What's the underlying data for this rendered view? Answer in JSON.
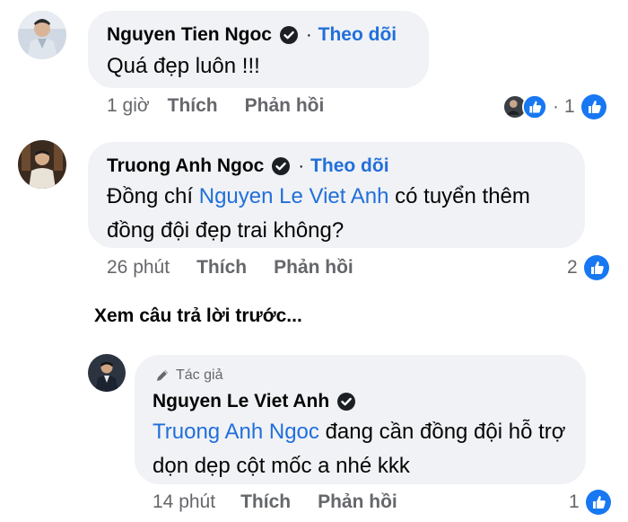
{
  "comments": [
    {
      "author": "Nguyen Tien Ngoc",
      "follow": "Theo dõi",
      "dot": "·",
      "text": "Quá đẹp luôn !!!",
      "time": "1 giờ",
      "like": "Thích",
      "reply": "Phản hồi",
      "reaction_count": "1",
      "reaction_dot": "·"
    },
    {
      "author": "Truong Anh Ngoc",
      "follow": "Theo dõi",
      "dot": "·",
      "text_before": "Đồng chí ",
      "mention": "Nguyen Le Viet Anh",
      "text_after": " có tuyển thêm đồng đội đẹp trai không?",
      "time": "26 phút",
      "like": "Thích",
      "reply": "Phản hồi",
      "reaction_count": "2"
    }
  ],
  "more_replies": "Xem câu trả lời trước...",
  "reply": {
    "badge": "Tác giả",
    "author": "Nguyen Le Viet Anh",
    "mention": "Truong Anh Ngoc",
    "text_after": " đang cần đồng đội hỗ trợ dọn dẹp cột mốc a nhé kkk",
    "time": "14 phút",
    "like": "Thích",
    "reply": "Phản hồi",
    "reaction_count": "1"
  },
  "colors": {
    "link": "#216fdb",
    "bubble": "#f0f2f5",
    "meta": "#65676b",
    "like_blue": "#1877f2"
  },
  "icons": {
    "verified": "verified-badge-icon",
    "like": "like-reaction-icon",
    "pen": "pen-icon"
  }
}
